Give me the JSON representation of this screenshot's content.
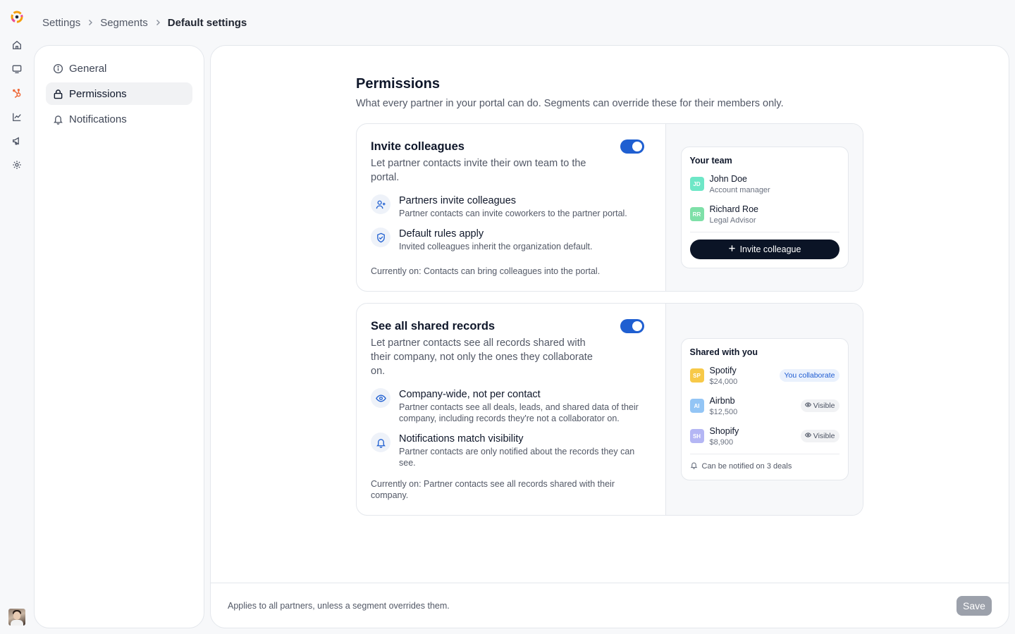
{
  "rail": {
    "icons": [
      "home-icon",
      "monitor-icon",
      "hubspot-icon",
      "chart-icon",
      "megaphone-icon",
      "gear-icon"
    ],
    "accent": "#ef6b3b"
  },
  "breadcrumb": {
    "items": [
      "Settings",
      "Segments"
    ],
    "current": "Default settings"
  },
  "subnav": {
    "items": [
      {
        "label": "General",
        "icon": "info-icon"
      },
      {
        "label": "Permissions",
        "icon": "lock-icon"
      },
      {
        "label": "Notifications",
        "icon": "bell-icon"
      }
    ],
    "active": "Permissions"
  },
  "page": {
    "title": "Permissions",
    "subtitle": "What every partner in your portal can do. Segments can override these for their members only."
  },
  "cards": [
    {
      "title": "Invite colleagues",
      "description": "Let partner contacts invite their own team to the portal.",
      "enabled": true,
      "features": [
        {
          "icon": "user-plus-icon",
          "title": "Partners invite colleagues",
          "desc": "Partner contacts can invite coworkers to the partner portal."
        },
        {
          "icon": "shield-check-icon",
          "title": "Default rules apply",
          "desc": "Invited colleagues inherit the organization default."
        }
      ],
      "note": "Currently on: Contacts can bring colleagues into the portal.",
      "preview": {
        "title": "Your team",
        "members": [
          {
            "initials": "JD",
            "name": "John Doe",
            "role": "Account manager",
            "color": "#6ee7c7"
          },
          {
            "initials": "RR",
            "name": "Richard Roe",
            "role": "Legal Advisor",
            "color": "#7ee0a8"
          }
        ],
        "button": "Invite colleague"
      }
    },
    {
      "title": "See all shared records",
      "description": "Let partner contacts see all records shared with their company, not only the ones they collaborate on.",
      "enabled": true,
      "features": [
        {
          "icon": "eye-icon",
          "title": "Company-wide, not per contact",
          "desc": "Partner contacts see all deals, leads, and shared data of their company, including records they're not a collaborator on."
        },
        {
          "icon": "bell-icon",
          "title": "Notifications match visibility",
          "desc": "Partner contacts are only notified about the records they can see."
        }
      ],
      "note": "Currently on: Partner contacts see all records shared with their company.",
      "preview": {
        "title": "Shared with you",
        "records": [
          {
            "initials": "SP",
            "name": "Spotify",
            "amount": "$24,000",
            "status": "You collaborate",
            "color": "#f7c948"
          },
          {
            "initials": "AI",
            "name": "Airbnb",
            "amount": "$12,500",
            "status": "Visible",
            "color": "#93c5f5"
          },
          {
            "initials": "SH",
            "name": "Shopify",
            "amount": "$8,900",
            "status": "Visible",
            "color": "#b4b6f4"
          }
        ],
        "footer": "Can be notified on 3 deals"
      }
    }
  ],
  "footer": {
    "text": "Applies to all partners, unless a segment overrides them.",
    "save": "Save"
  }
}
